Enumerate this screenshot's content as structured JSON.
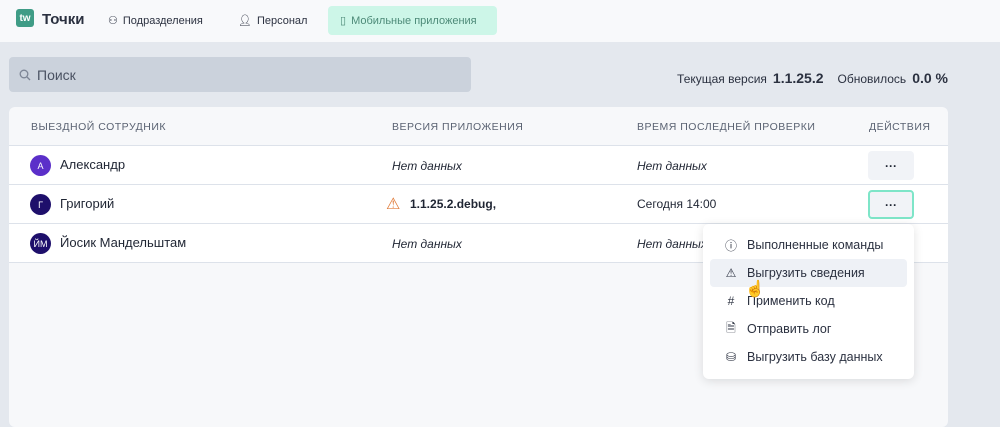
{
  "header": {
    "logo": "tw",
    "brand": "Точки",
    "nav": [
      {
        "label": "Подразделения",
        "icon": "hierarchy-icon"
      },
      {
        "label": "Персонал",
        "icon": "user-icon"
      },
      {
        "label": "Мобильные приложения",
        "icon": "phone-icon",
        "active": true
      }
    ]
  },
  "search": {
    "placeholder": "Поиск"
  },
  "version": {
    "current_label": "Текущая версия",
    "current": "1.1.25.2",
    "updated_label": "Обновилось",
    "updated": "0.0 %"
  },
  "table": {
    "columns": [
      "ВЫЕЗДНОЙ СОТРУДНИК",
      "ВЕРСИЯ ПРИЛОЖЕНИЯ",
      "ВРЕМЯ ПОСЛЕДНЕЙ ПРОВЕРКИ",
      "ДЕЙСТВИЯ"
    ],
    "rows": [
      {
        "initials": "А",
        "name": "Александр",
        "version": "Нет данных",
        "checked": "Нет данных",
        "color": "#5b2fc9"
      },
      {
        "initials": "Г",
        "name": "Григорий",
        "version": "1.1.25.2.debug,",
        "checked": "Сегодня 14:00",
        "color": "#1e0f6b",
        "warning": true
      },
      {
        "initials": "ЙМ",
        "name": "Йосик Мандельштам",
        "version": "Нет данных",
        "checked": "Нет данных",
        "color": "#1e0f6b"
      }
    ],
    "actions_label": "···"
  },
  "menu": {
    "items": [
      {
        "label": "Выполненные команды",
        "icon": "info-icon"
      },
      {
        "label": "Выгрузить сведения",
        "icon": "cloud-upload-icon"
      },
      {
        "label": "Применить код",
        "icon": "hash-icon"
      },
      {
        "label": "Отправить лог",
        "icon": "document-icon"
      },
      {
        "label": "Выгрузить базу данных",
        "icon": "database-icon"
      }
    ]
  }
}
